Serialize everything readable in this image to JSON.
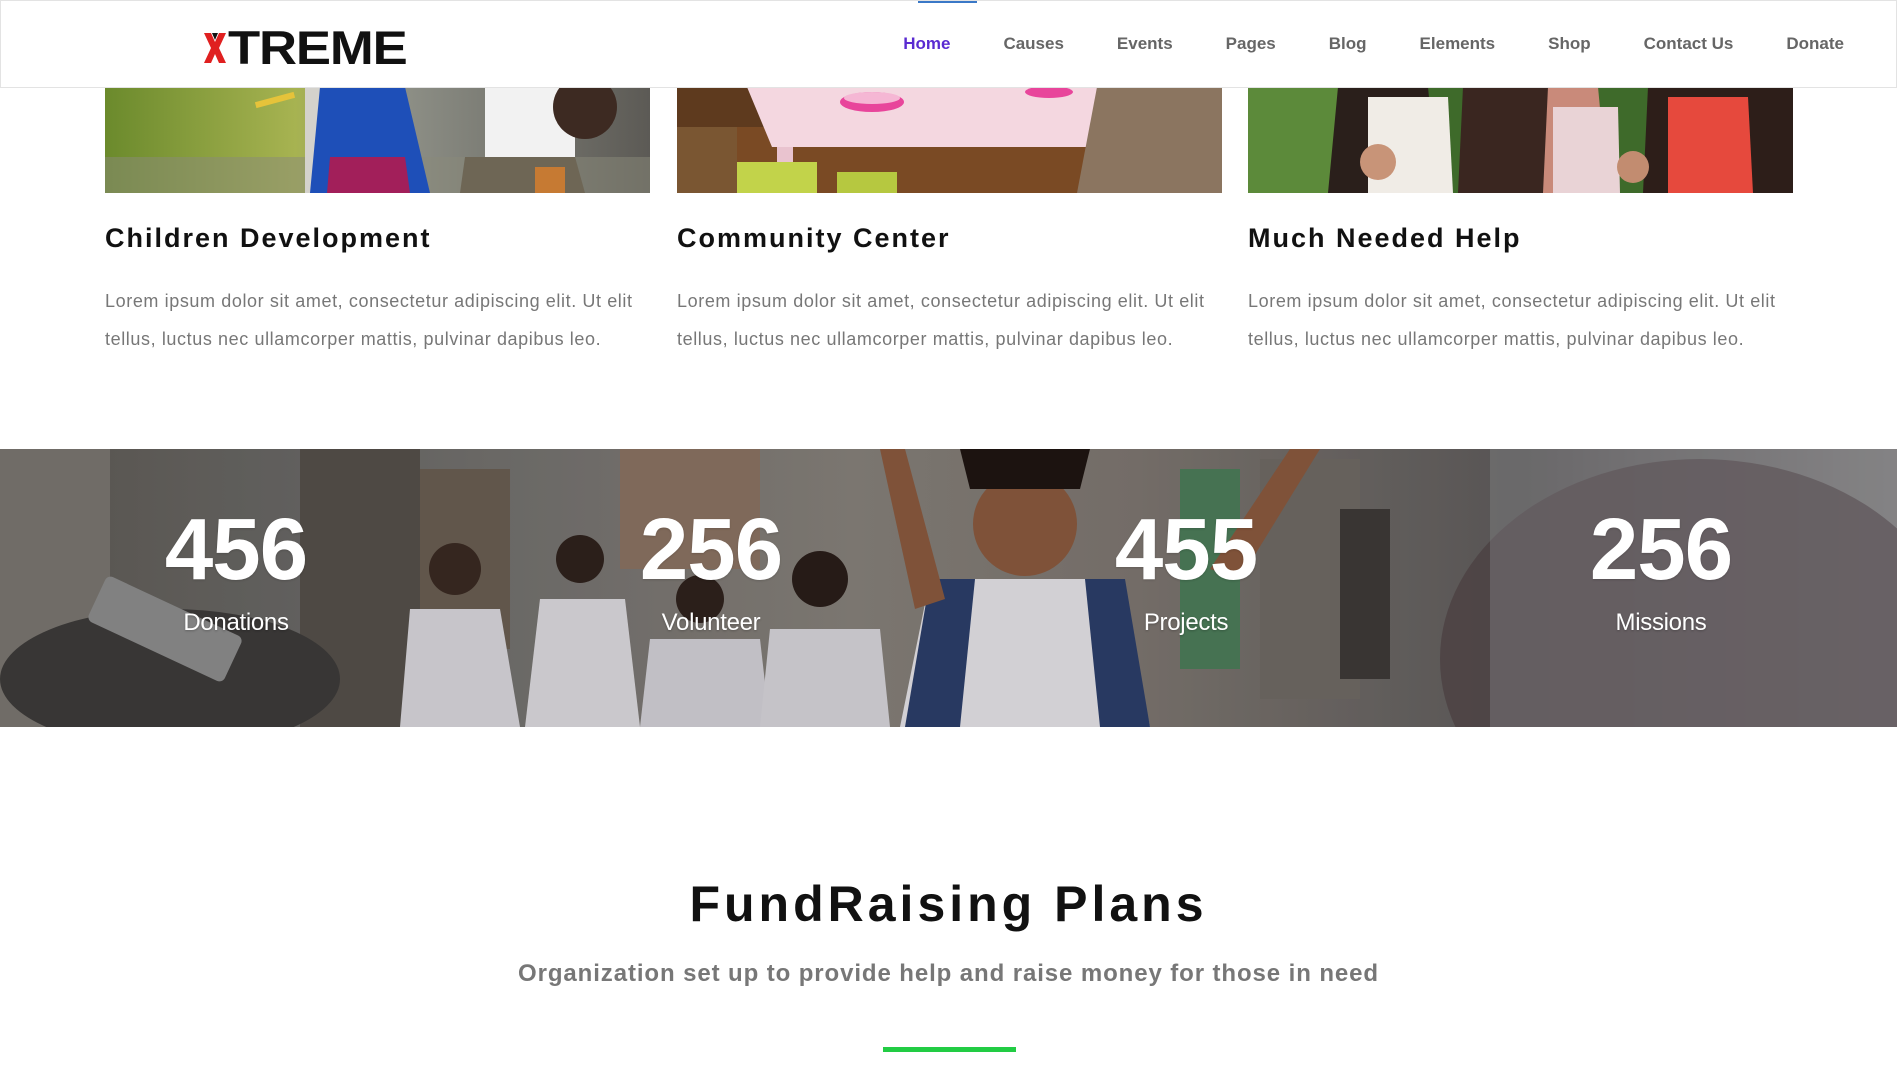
{
  "brand": {
    "logo_text": "TREME",
    "accent_color": "#e02020"
  },
  "nav": {
    "items": [
      {
        "label": "Home",
        "active": true
      },
      {
        "label": "Causes"
      },
      {
        "label": "Events"
      },
      {
        "label": "Pages"
      },
      {
        "label": "Blog"
      },
      {
        "label": "Elements"
      },
      {
        "label": "Shop"
      },
      {
        "label": "Contact Us"
      },
      {
        "label": "Donate"
      }
    ],
    "active_color": "#5a2bd1"
  },
  "causes": [
    {
      "title": "Children Development",
      "text": "Lorem ipsum dolor sit amet, consectetur adipiscing elit. Ut elit tellus, luctus nec ullamcorper mattis, pulvinar dapibus leo."
    },
    {
      "title": "Community Center",
      "text": "Lorem ipsum dolor sit amet, consectetur adipiscing elit. Ut elit tellus, luctus nec ullamcorper mattis, pulvinar dapibus leo."
    },
    {
      "title": "Much Needed Help",
      "text": "Lorem ipsum dolor sit amet, consectetur adipiscing elit. Ut elit tellus, luctus nec ullamcorper mattis, pulvinar dapibus leo."
    }
  ],
  "stats": [
    {
      "number": "456",
      "label": "Donations"
    },
    {
      "number": "256",
      "label": "Volunteer"
    },
    {
      "number": "455",
      "label": "Projects"
    },
    {
      "number": "256",
      "label": "Missions"
    }
  ],
  "fundraising": {
    "title": "FundRaising Plans",
    "subtitle": "Organization set up to provide help and raise money for those in need",
    "divider_color": "#22cc44"
  }
}
